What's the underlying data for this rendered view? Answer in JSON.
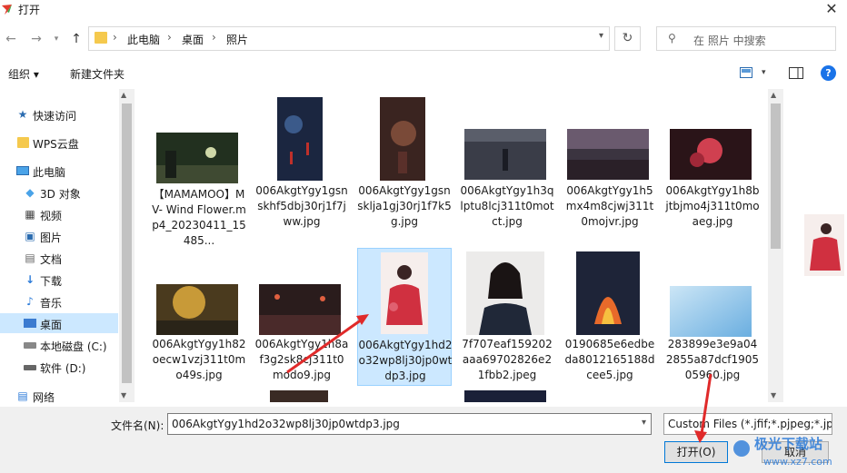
{
  "window": {
    "title": "打开"
  },
  "nav": {
    "breadcrumbs": [
      "此电脑",
      "桌面",
      "照片"
    ],
    "search_placeholder": "在 照片 中搜索"
  },
  "toolbar": {
    "organize": "组织 ▾",
    "new_folder": "新建文件夹"
  },
  "sidebar": {
    "items": [
      {
        "label": "快速访问",
        "icon": "star-icon"
      },
      {
        "label": "WPS云盘",
        "icon": "cloud-folder-icon"
      },
      {
        "label": "此电脑",
        "icon": "computer-icon"
      },
      {
        "label": "3D 对象",
        "icon": "cube-icon"
      },
      {
        "label": "视频",
        "icon": "video-icon"
      },
      {
        "label": "图片",
        "icon": "picture-icon"
      },
      {
        "label": "文档",
        "icon": "document-icon"
      },
      {
        "label": "下载",
        "icon": "download-icon"
      },
      {
        "label": "音乐",
        "icon": "music-icon"
      },
      {
        "label": "桌面",
        "icon": "desktop-icon",
        "selected": true
      },
      {
        "label": "本地磁盘 (C:)",
        "icon": "drive-icon"
      },
      {
        "label": "软件 (D:)",
        "icon": "drive-icon"
      },
      {
        "label": "网络",
        "icon": "network-icon"
      }
    ]
  },
  "files": [
    {
      "name": "【MAMAMOO】MV- Wind Flower.mp4_20230411_15485...",
      "thumb": "#2b3a2e"
    },
    {
      "name": "006AkgtYgy1gsnskhf5dbj30rj1f7jww.jpg",
      "thumb": "#1b2640"
    },
    {
      "name": "006AkgtYgy1gsnsklja1gj30rj1f7k5g.jpg",
      "thumb": "#4a2e28"
    },
    {
      "name": "006AkgtYgy1h3qlptu8lcj311t0motct.jpg",
      "thumb": "#3a3d48"
    },
    {
      "name": "006AkgtYgy1h5mx4m8cjwj311t0mojvr.jpg",
      "thumb": "#3b3440"
    },
    {
      "name": "006AkgtYgy1h8bjtbjmo4j311t0moaeg.jpg",
      "thumb": "#3a1a1e"
    },
    {
      "name": "006AkgtYgy1h82oecw1vzj311t0mo49s.jpg",
      "thumb": "#6a5530"
    },
    {
      "name": "006AkgtYgy1h8af3g2sk8cj311t0modo9.jpg",
      "thumb": "#3a2a2a"
    },
    {
      "name": "006AkgtYgy1hd2o32wp8lj30jp0wtdp3.jpg",
      "thumb": "#f2e8e6",
      "selected": true
    },
    {
      "name": "7f707eaf159202aaa69702826e21fbb2.jpeg",
      "thumb": "#e8e6e4"
    },
    {
      "name": "0190685e6edbeda8012165188dcee5.jpg",
      "thumb": "#1e2438"
    },
    {
      "name": "283899e3e9a042855a87dcf190505960.jpg",
      "thumb": "#a8d2ec"
    }
  ],
  "bottom": {
    "filename_label": "文件名(N):",
    "filename_value": "006AkgtYgy1hd2o32wp8lj30jp0wtdp3.jpg",
    "filetype_value": "Custom Files (*.jfif;*.pjpeg;*.jpeg;*.pjp;*.jpg)",
    "open_label": "打开(O)",
    "cancel_label": "取消"
  },
  "colors": {
    "accent": "#0078d7",
    "selection": "#cce8ff",
    "help": "#1a73e8",
    "arrow_red": "#e02a2a"
  },
  "watermark": {
    "text": "极光下载站",
    "url": "www.xz7.com"
  }
}
